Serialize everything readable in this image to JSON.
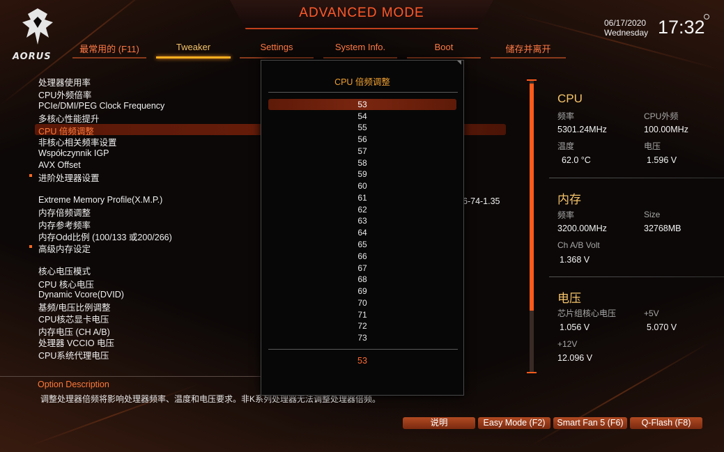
{
  "header": {
    "title": "ADVANCED MODE",
    "logo_text": "AORUS",
    "date": "06/17/2020",
    "weekday": "Wednesday",
    "time": "17:32"
  },
  "tabs": [
    {
      "label": "最常用的 (F11)",
      "active": false
    },
    {
      "label": "Tweaker",
      "active": true
    },
    {
      "label": "Settings",
      "active": false
    },
    {
      "label": "System Info.",
      "active": false
    },
    {
      "label": "Boot",
      "active": false
    },
    {
      "label": "储存并离开",
      "active": false
    }
  ],
  "menu": {
    "items": [
      {
        "label": "处理器使用率"
      },
      {
        "label": "CPU外频倍率"
      },
      {
        "label": "PCIe/DMI/PEG Clock Frequency"
      },
      {
        "label": "多核心性能提升"
      },
      {
        "label": "CPU 倍频调整",
        "selected": true
      },
      {
        "label": "非核心相关频率设置"
      },
      {
        "label": "Współczynnik IGP"
      },
      {
        "label": "AVX Offset"
      },
      {
        "label": "进阶处理器设置",
        "bullet": true
      },
      {
        "label": "Extreme Memory Profile(X.M.P.)"
      },
      {
        "label": "内存倍频调整"
      },
      {
        "label": "内存参考频率"
      },
      {
        "label": "内存Odd比例 (100/133 或200/266)"
      },
      {
        "label": "高级内存设定",
        "bullet": true
      },
      {
        "label": "核心电压模式"
      },
      {
        "label": "CPU 核心电压"
      },
      {
        "label": "Dynamic Vcore(DVID)"
      },
      {
        "label": "基频/电压比例调整"
      },
      {
        "label": "CPU核芯显卡电压"
      },
      {
        "label": "内存电压 (CH A/B)"
      },
      {
        "label": "处理器 VCCIO 电压"
      },
      {
        "label": "CPU系统代理电压"
      }
    ],
    "xmp_value_fragment": "6-74-1.35"
  },
  "popup": {
    "title": "CPU 倍频调整",
    "options": [
      "53",
      "54",
      "55",
      "56",
      "57",
      "58",
      "59",
      "60",
      "61",
      "62",
      "63",
      "64",
      "65",
      "66",
      "67",
      "68",
      "69",
      "70",
      "71",
      "72",
      "73"
    ],
    "selected": "53",
    "current_value": "53"
  },
  "info": {
    "cpu": {
      "heading": "CPU",
      "freq_label": "频率",
      "freq_value": "5301.24MHz",
      "bclk_label": "CPU外频",
      "bclk_value": "100.00MHz",
      "temp_label": "温度",
      "temp_value": "62.0 °C",
      "volt_label": "电压",
      "volt_value": "1.596 V"
    },
    "memory": {
      "heading": "内存",
      "freq_label": "频率",
      "freq_value": "3200.00MHz",
      "size_label": "Size",
      "size_value": "32768MB",
      "volt_label": "Ch A/B Volt",
      "volt_value": "1.368 V"
    },
    "voltage": {
      "heading": "电压",
      "chipset_label": "芯片组核心电压",
      "chipset_value": "1.056 V",
      "v5_label": "+5V",
      "v5_value": "5.070 V",
      "v12_label": "+12V",
      "v12_value": "12.096 V"
    }
  },
  "description": {
    "title": "Option Description",
    "text": "调整处理器倍频将影响处理器频率、温度和电压要求。非K系列处理器无法调整处理器倍频。"
  },
  "buttons": {
    "help": "说明",
    "easy_mode": "Easy Mode (F2)",
    "smart_fan": "Smart Fan 5 (F6)",
    "qflash": "Q-Flash (F8)"
  },
  "colors": {
    "accent": "#ff5a2a",
    "tab_active": "#f4c36a",
    "heading": "#f4c36a",
    "selection": "#6a1e0a"
  }
}
